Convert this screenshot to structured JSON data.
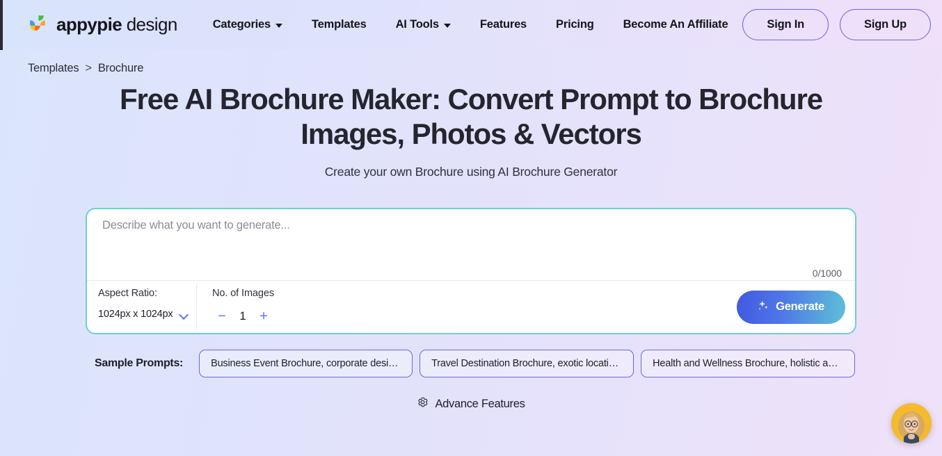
{
  "header": {
    "brand_bold": "appypie",
    "brand_light": "design",
    "nav": [
      {
        "label": "Categories",
        "has_caret": true
      },
      {
        "label": "Templates",
        "has_caret": false
      },
      {
        "label": "AI Tools",
        "has_caret": true
      },
      {
        "label": "Features",
        "has_caret": false
      },
      {
        "label": "Pricing",
        "has_caret": false
      },
      {
        "label": "Become An Affiliate",
        "has_caret": false
      }
    ],
    "sign_in": "Sign In",
    "sign_up": "Sign Up"
  },
  "breadcrumb": {
    "parent": "Templates",
    "separator": ">",
    "current": "Brochure"
  },
  "hero": {
    "title": "Free AI Brochure Maker: Convert Prompt to Brochure Images, Photos & Vectors",
    "subtitle": "Create your own Brochure using AI Brochure Generator"
  },
  "prompt": {
    "placeholder": "Describe what you want to generate...",
    "value": "",
    "char_count": "0/1000",
    "aspect_ratio_label": "Aspect Ratio:",
    "aspect_ratio_value": "1024px x 1024px",
    "images_label": "No. of Images",
    "images_value": "1",
    "decrement": "−",
    "increment": "+",
    "generate_label": "Generate"
  },
  "samples": {
    "label": "Sample Prompts:",
    "items": [
      "Business Event Brochure, corporate design, cle…",
      "Travel Destination Brochure, exotic locations, p…",
      "Health and Wellness Brochure, holistic approa…"
    ]
  },
  "advance": {
    "label": "Advance Features"
  },
  "colors": {
    "accent_blue": "#5b77f0",
    "accent_purple": "#6b66e8",
    "panel_border_teal": "#6fd0cf",
    "generate_gradient_from": "#4259e0",
    "generate_gradient_to": "#5fc0d6",
    "bg_gradient_from": "#dae5fc",
    "bg_gradient_to": "#efe1fa"
  }
}
